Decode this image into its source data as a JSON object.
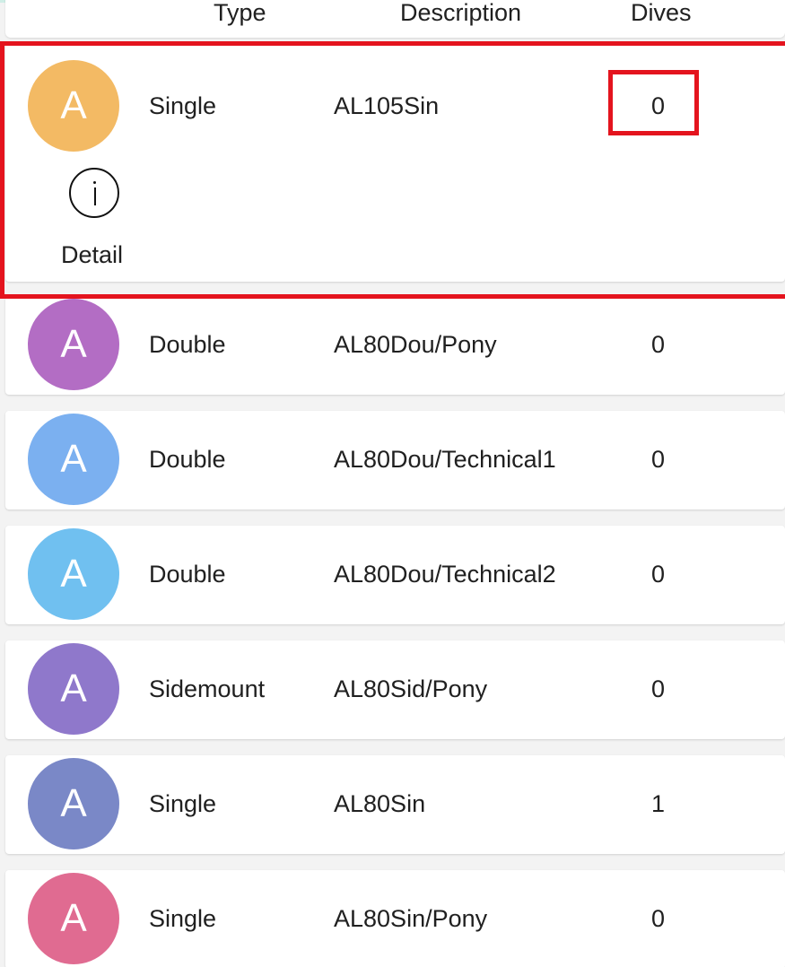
{
  "header": {
    "type_label": "Type",
    "description_label": "Description",
    "dives_label": "Dives"
  },
  "rows": [
    {
      "avatar": "A",
      "type": "Single",
      "description": "AL105Sin",
      "dives": "0",
      "avatar_color": "#F3BA64",
      "expanded": true,
      "detail_label": "Detail"
    },
    {
      "avatar": "A",
      "type": "Double",
      "description": "AL80Dou/Pony",
      "dives": "0",
      "avatar_color": "#B36DC4"
    },
    {
      "avatar": "A",
      "type": "Double",
      "description": "AL80Dou/Technical1",
      "dives": "0",
      "avatar_color": "#7BB0F0"
    },
    {
      "avatar": "A",
      "type": "Double",
      "description": "AL80Dou/Technical2",
      "dives": "0",
      "avatar_color": "#70C0F0"
    },
    {
      "avatar": "A",
      "type": "Sidemount",
      "description": "AL80Sid/Pony",
      "dives": "0",
      "avatar_color": "#8F78CB"
    },
    {
      "avatar": "A",
      "type": "Single",
      "description": "AL80Sin",
      "dives": "1",
      "avatar_color": "#7A88C7"
    },
    {
      "avatar": "A",
      "type": "Single",
      "description": "AL80Sin/Pony",
      "dives": "0",
      "avatar_color": "#E06B91"
    }
  ],
  "colors": {
    "highlight": "#E4141E",
    "background": "#F3F3F3",
    "card": "#FFFFFF"
  }
}
